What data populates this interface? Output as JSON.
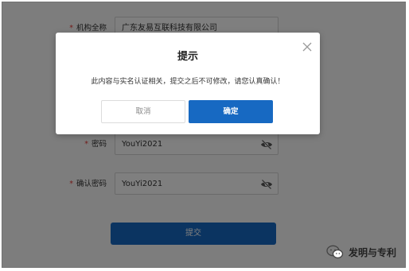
{
  "form": {
    "fields": [
      {
        "label": "机构全称",
        "value": "广东友易互联科技有限公司"
      },
      {
        "label": "密码",
        "value": "YouYi2021"
      },
      {
        "label": "确认密码",
        "value": "YouYi2021"
      }
    ],
    "required_mark": "*",
    "submit_label": "提交"
  },
  "dialog": {
    "title": "提示",
    "message": "此内容与实名认证相关，提交之后不可修改，请您认真确认！",
    "cancel_label": "取消",
    "confirm_label": "确定"
  },
  "watermark": {
    "text": "发明与专利",
    "icon": "wechat-icon"
  },
  "colors": {
    "primary": "#1769c2",
    "required": "#e53935",
    "overlay": "rgba(0,0,0,0.5)"
  },
  "icons": {
    "password_toggle": "eye-off-icon",
    "close": "close-icon"
  }
}
